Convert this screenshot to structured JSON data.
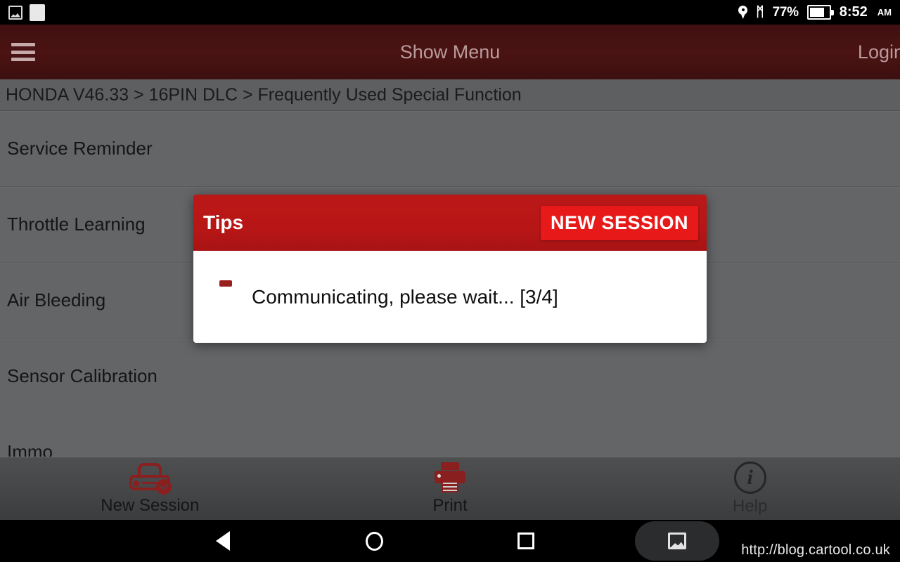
{
  "status_bar": {
    "notification_icons": [
      "image-notification-icon",
      "white-square-notification-icon"
    ],
    "location_icon": "location-pin-icon",
    "bluetooth_icon": "bluetooth-icon",
    "bluetooth_glyph": "ᛗ",
    "battery_percent": "77%",
    "battery_level": 77,
    "battery_icon": "battery-icon",
    "time": "8:52",
    "am_pm": "AM"
  },
  "app_bar": {
    "menu_icon": "hamburger-menu-icon",
    "title": "Show Menu",
    "login_label": "Login",
    "background_color": "#4b1313",
    "text_color": "#b99a9a"
  },
  "breadcrumb": {
    "text": "HONDA V46.33 > 16PIN DLC > Frequently Used Special Function"
  },
  "function_list": {
    "items": [
      {
        "label": "Service Reminder"
      },
      {
        "label": "Throttle Learning"
      },
      {
        "label": "Air Bleeding"
      },
      {
        "label": "Sensor Calibration"
      },
      {
        "label": "Immo"
      }
    ],
    "background_color": "#646567"
  },
  "dialog": {
    "title": "Tips",
    "action_label": "NEW SESSION",
    "message": "Communicating, please wait... [3/4]",
    "progress_step": 3,
    "progress_total": 4,
    "header_color": "#b81616",
    "action_color": "#e81919",
    "body_color": "#ffffff",
    "spinner_icon": "loading-spinner-icon"
  },
  "toolbar": {
    "items": [
      {
        "label": "New Session",
        "icon": "car-check-icon",
        "disabled": false
      },
      {
        "label": "Print",
        "icon": "printer-icon",
        "disabled": false
      },
      {
        "label": "Help",
        "icon": "info-circle-icon",
        "disabled": true
      }
    ],
    "accent_color": "#8a1f1f"
  },
  "nav_bar": {
    "back_icon": "back-triangle-icon",
    "home_icon": "home-circle-icon",
    "recents_icon": "recents-square-icon",
    "screenshot_icon": "screenshot-image-icon"
  },
  "watermark": {
    "url": "http://blog.cartool.co.uk"
  }
}
